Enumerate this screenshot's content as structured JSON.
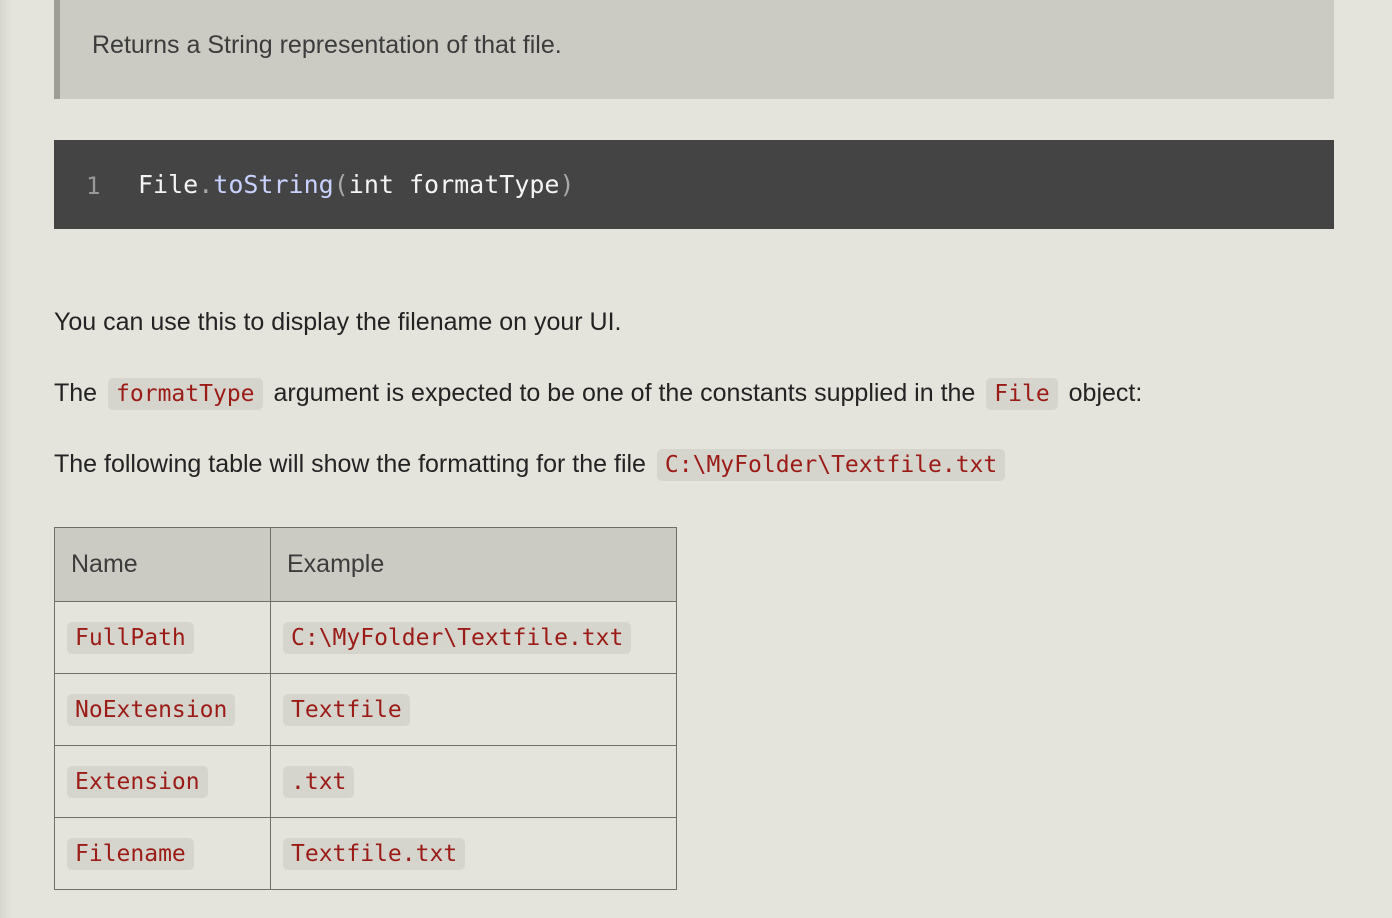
{
  "blockquote": {
    "text": "Returns a String representation of that file."
  },
  "code": {
    "line_number": "1",
    "tokens": {
      "class": "File",
      "dot": ".",
      "method": "toString",
      "open": "(",
      "args": "int formatType",
      "close": ")"
    }
  },
  "paragraphs": {
    "p1": "You can use this to display the filename on your UI.",
    "p2_before": "The",
    "p2_code1": "formatType",
    "p2_middle": "argument is expected to be one of the constants supplied in the",
    "p2_code2": "File",
    "p2_after": "object:",
    "p3_before": "The following table will show the formatting for the file",
    "p3_code": "C:\\MyFolder\\Textfile.txt"
  },
  "table": {
    "headers": [
      "Name",
      "Example"
    ],
    "rows": [
      {
        "name": "FullPath",
        "example": "C:\\MyFolder\\Textfile.txt"
      },
      {
        "name": "NoExtension",
        "example": "Textfile"
      },
      {
        "name": "Extension",
        "example": ".txt"
      },
      {
        "name": "Filename",
        "example": "Textfile.txt"
      }
    ]
  }
}
